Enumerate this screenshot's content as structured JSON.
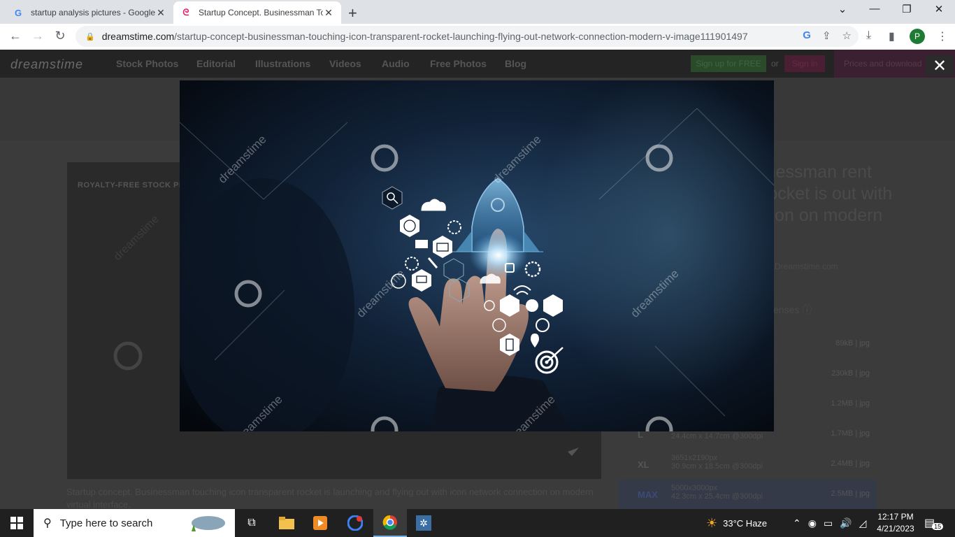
{
  "browser": {
    "tabs": [
      {
        "title": "startup analysis pictures - Google",
        "favicon": "google-icon"
      },
      {
        "title": "Startup Concept. Businessman To",
        "favicon": "dreamstime-icon"
      }
    ],
    "url_domain": "dreamstime.com",
    "url_path": "/startup-concept-businessman-touching-icon-transparent-rocket-launching-flying-out-network-connection-modern-v-image111901497",
    "profile_initial": "P",
    "accent_color": "#1e7b34"
  },
  "site": {
    "logo": "dreamstime",
    "nav": [
      "Stock Photos",
      "Editorial",
      "Illustrations",
      "Videos",
      "Audio",
      "Free Photos",
      "Blog"
    ],
    "signup": "Sign up for FREE",
    "or": "or",
    "signin": "Sign in",
    "prices": "Prices and download",
    "close": "✕",
    "royalty_free": "ROYALTY-FREE STOCK PH",
    "title_fragment": "inessman rent rocket is out with icon on modern",
    "credit": "Dreamstime.com",
    "licenses": "enses",
    "caption": "Startup concept. Businessman touching icon transparent rocket is launching and flying out with icon network connection on modern virtual interface.",
    "watermark": "dreamstime",
    "sizes": [
      {
        "label": "",
        "res": "",
        "dim": "",
        "file": "89kB | jpg"
      },
      {
        "label": "",
        "res": "",
        "dim": "",
        "file": "230kB | jpg"
      },
      {
        "label": "",
        "res": "",
        "dim": "",
        "file": "1.2MB | jpg"
      },
      {
        "label": "L",
        "res": "",
        "dim": "24.4cm x 14.7cm @300dpi",
        "file": "1.7MB | jpg"
      },
      {
        "label": "XL",
        "res": "3651x2190px",
        "dim": "30.9cm x 18.5cm @300dpi",
        "file": "2.4MB | jpg"
      },
      {
        "label": "MAX",
        "res": "5000x3000px",
        "dim": "42.3cm x 25.4cm @300dpi",
        "file": "2.5MB | jpg"
      }
    ]
  },
  "taskbar": {
    "search_placeholder": "Type here to search",
    "weather": "33°C  Haze",
    "time": "12:17 PM",
    "date": "4/21/2023",
    "notifications": "15"
  }
}
